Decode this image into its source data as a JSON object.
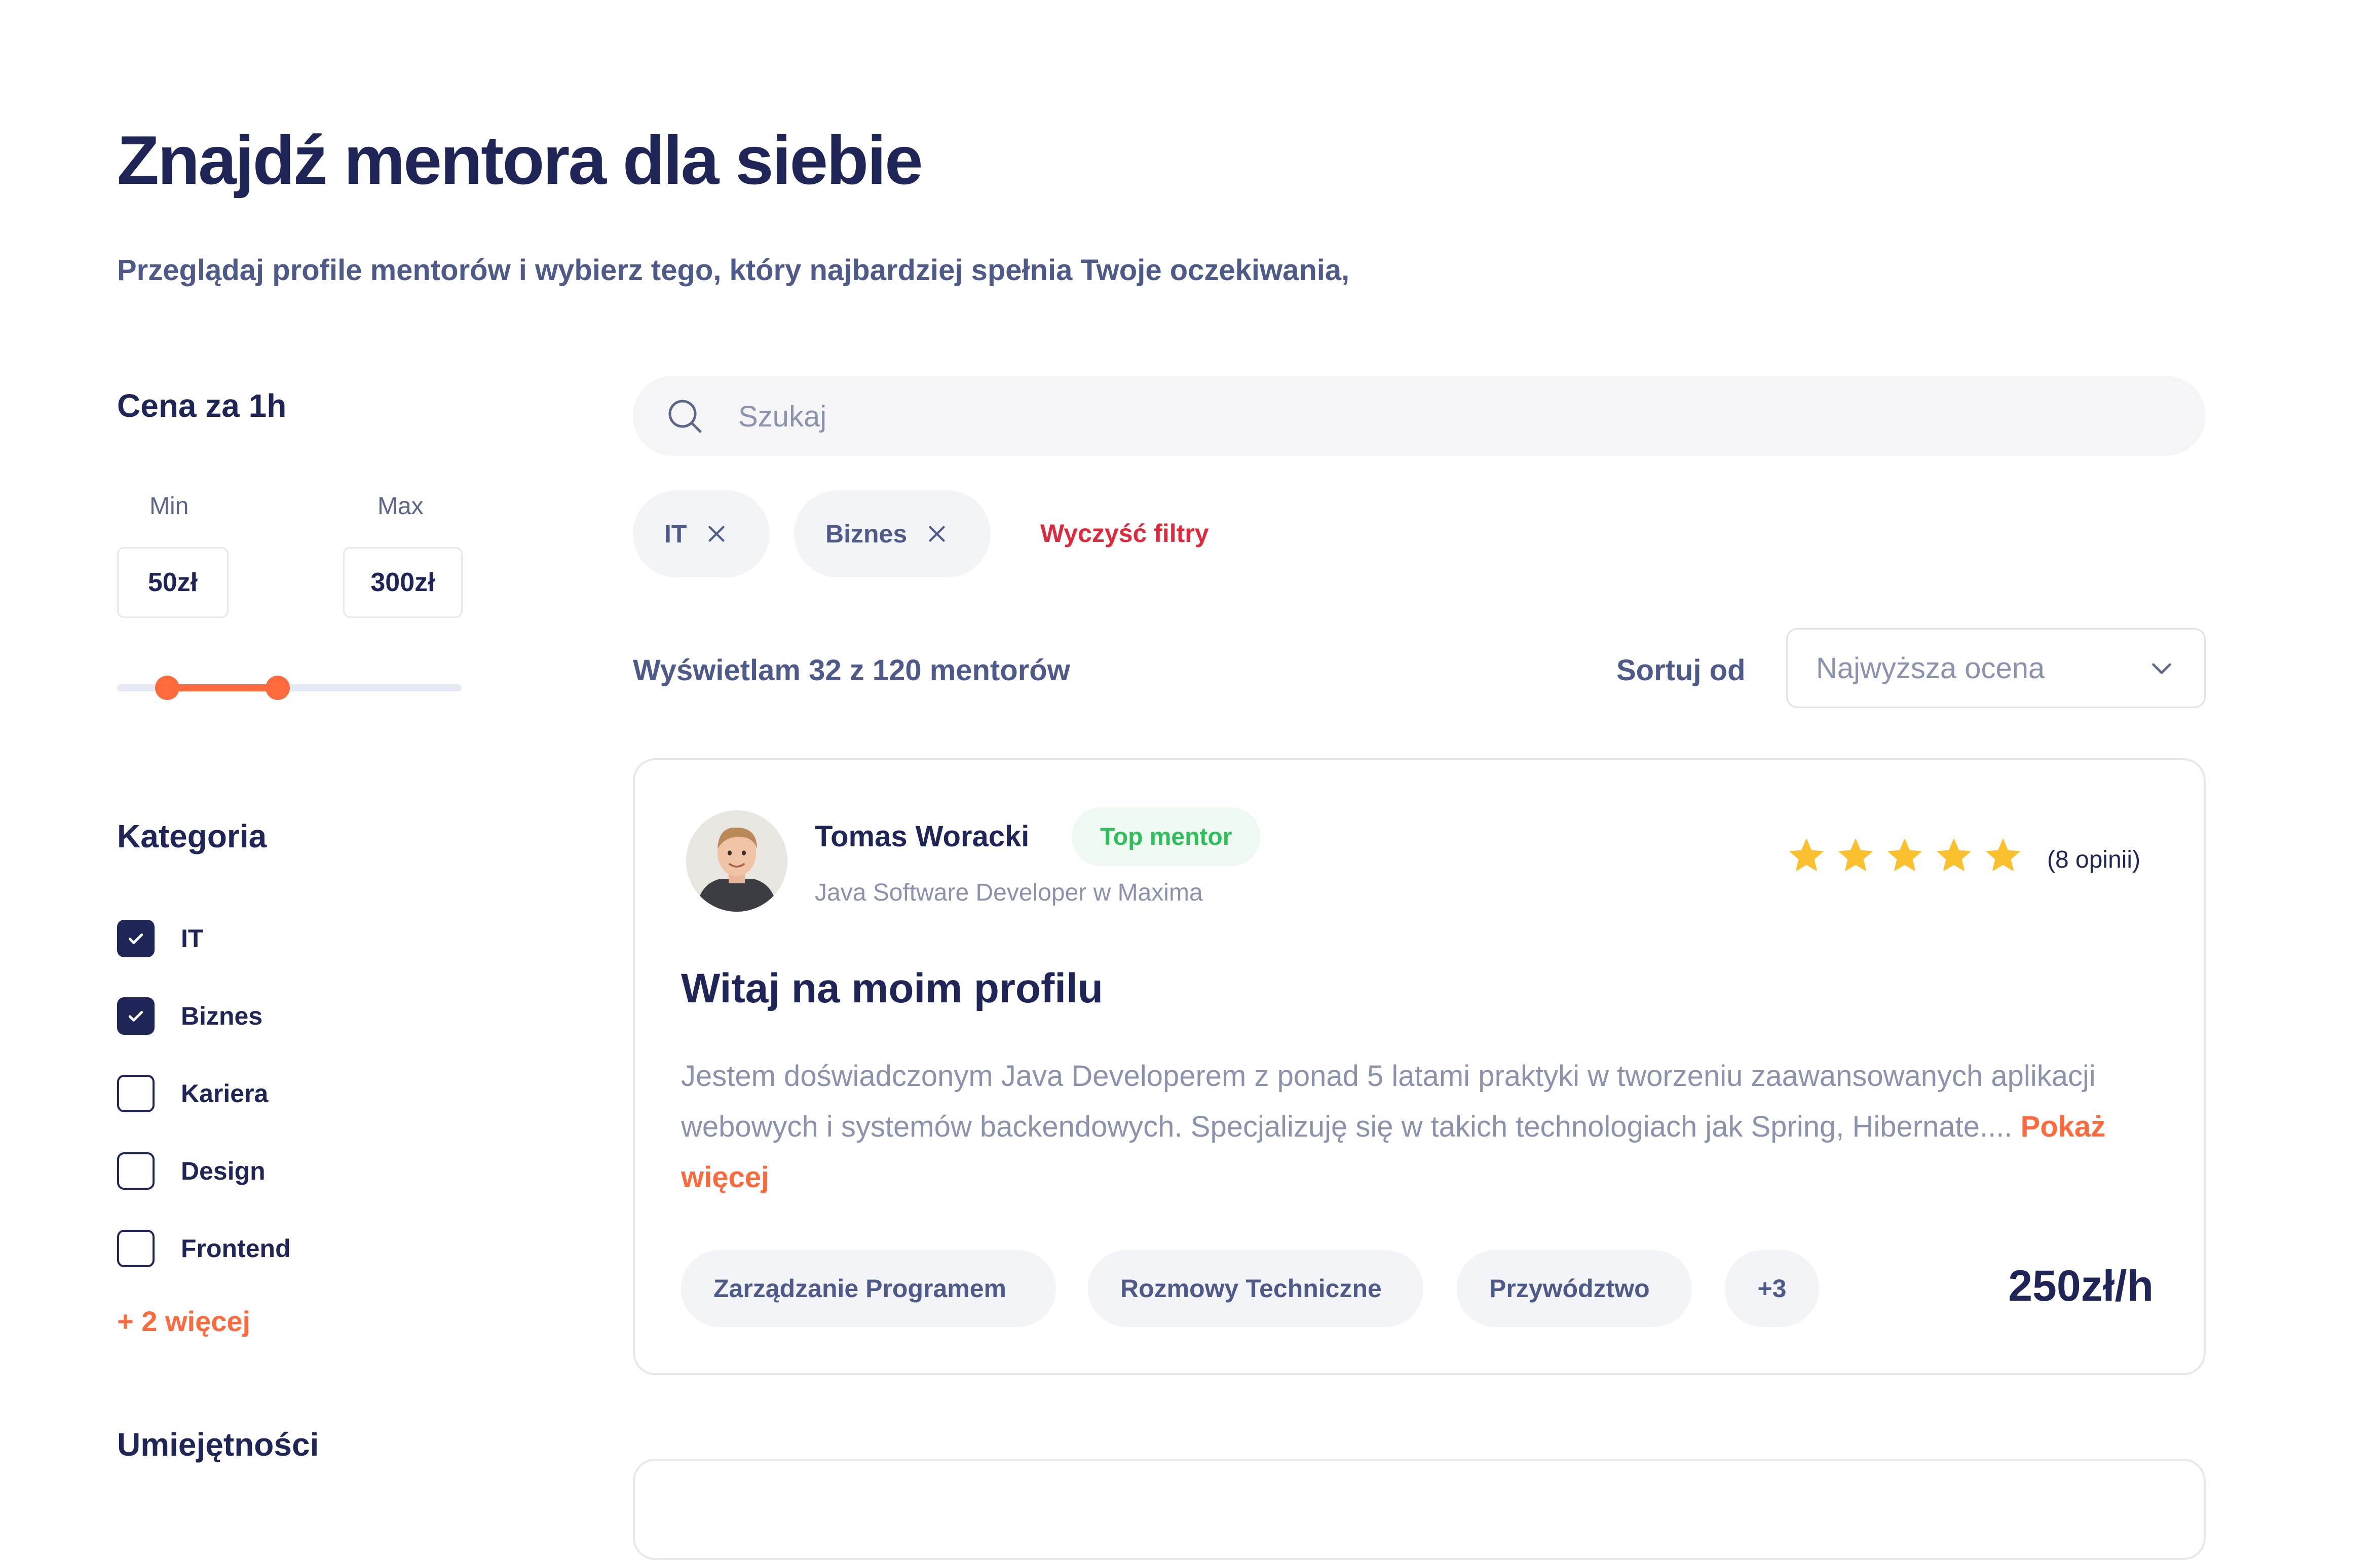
{
  "header": {
    "title": "Znajdź mentora dla siebie",
    "subtitle": "Przeglądaj profile mentorów i wybierz tego, który najbardziej spełnia Twoje oczekiwania,"
  },
  "filters": {
    "price": {
      "heading": "Cena za 1h",
      "min_label": "Min",
      "max_label": "Max",
      "min_value": "50zł",
      "max_value": "300zł",
      "range_fill_start": 0.15,
      "range_fill_end": 0.47,
      "accent": "#ff6a3d"
    },
    "category": {
      "heading": "Kategoria",
      "items": [
        {
          "label": "IT",
          "checked": true
        },
        {
          "label": "Biznes",
          "checked": true
        },
        {
          "label": "Kariera",
          "checked": false
        },
        {
          "label": "Design",
          "checked": false
        },
        {
          "label": "Frontend",
          "checked": false
        }
      ],
      "more_label": "+ 2 więcej"
    },
    "skills": {
      "heading": "Umiejętności"
    }
  },
  "search": {
    "placeholder": "Szukaj",
    "icon": "search-icon"
  },
  "active_filters": {
    "chips": [
      {
        "label": "IT",
        "icon": "close-icon"
      },
      {
        "label": "Biznes",
        "icon": "close-icon"
      }
    ],
    "clear_label": "Wyczyść filtry"
  },
  "results": {
    "count_text": "Wyświetlam 32 z 120 mentorów",
    "sort_label": "Sortuj od",
    "sort_value": "Najwyższa ocena"
  },
  "mentor_card": {
    "name": "Tomas Woracki",
    "badge": "Top mentor",
    "role": "Java Software Developer w Maxima",
    "rating": 5,
    "reviews": "(8 opinii)",
    "title": "Witaj na moim profilu",
    "description": "Jestem doświadczonym Java Developerem z ponad 5 latami praktyki w tworzeniu zaawansowanych aplikacji webowych i systemów backendowych. Specjalizuję się w takich technologiach jak Spring, Hibernate....",
    "show_more": "Pokaż więcej",
    "tags": [
      "Zarządzanie Programem",
      "Rozmowy Techniczne",
      "Przywództwo",
      "+3"
    ],
    "price": "250zł/h"
  },
  "colors": {
    "primary": "#1f2557",
    "accent": "#ff6a3d",
    "success": "#2fbf5a",
    "danger": "#e0293d",
    "star": "#fbc02d"
  }
}
